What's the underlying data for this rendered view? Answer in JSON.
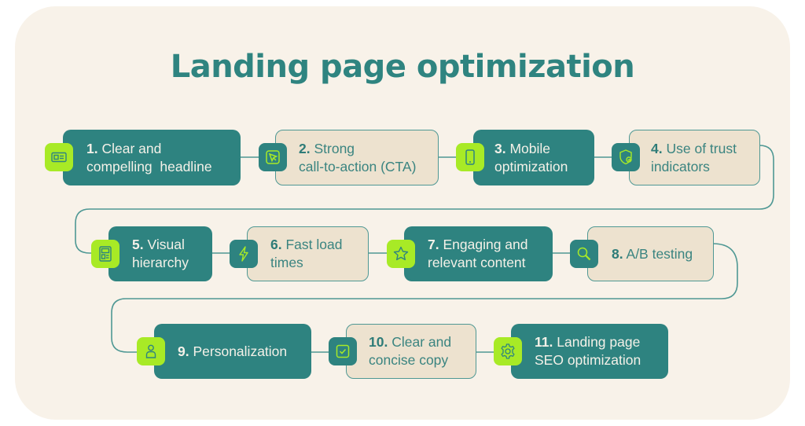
{
  "title": "Landing page optimization",
  "colors": {
    "background": "#f8f2e9",
    "teal": "#2e8380",
    "lime": "#a8ea26",
    "beige": "#ede2cf"
  },
  "steps": [
    {
      "num": "1.",
      "line1": "Clear and",
      "line2": "compelling  headline",
      "icon": "id-card-icon",
      "style": "dark"
    },
    {
      "num": "2.",
      "line1": "Strong",
      "line2": "call-to-action (CTA)",
      "icon": "cursor-arrow-icon",
      "style": "light"
    },
    {
      "num": "3.",
      "line1": "Mobile",
      "line2": "optimization",
      "icon": "smartphone-icon",
      "style": "dark"
    },
    {
      "num": "4.",
      "line1": "Use of trust",
      "line2": "indicators",
      "icon": "shield-check-icon",
      "style": "light"
    },
    {
      "num": "5.",
      "line1": "Visual",
      "line2": "hierarchy",
      "icon": "layout-icon",
      "style": "dark"
    },
    {
      "num": "6.",
      "line1": "Fast load",
      "line2": "times",
      "icon": "lightning-icon",
      "style": "light"
    },
    {
      "num": "7.",
      "line1": "Engaging and",
      "line2": "relevant content",
      "icon": "star-icon",
      "style": "dark"
    },
    {
      "num": "8.",
      "line1": "A/B testing",
      "line2": "",
      "icon": "magnifier-icon",
      "style": "light"
    },
    {
      "num": "9.",
      "line1": "Personalization",
      "line2": "",
      "icon": "user-icon",
      "style": "dark"
    },
    {
      "num": "10.",
      "line1": "Clear and",
      "line2": "concise copy",
      "icon": "checkbox-icon",
      "style": "light"
    },
    {
      "num": "11.",
      "line1": "Landing page",
      "line2": "SEO optimization",
      "icon": "gear-icon",
      "style": "dark"
    }
  ]
}
